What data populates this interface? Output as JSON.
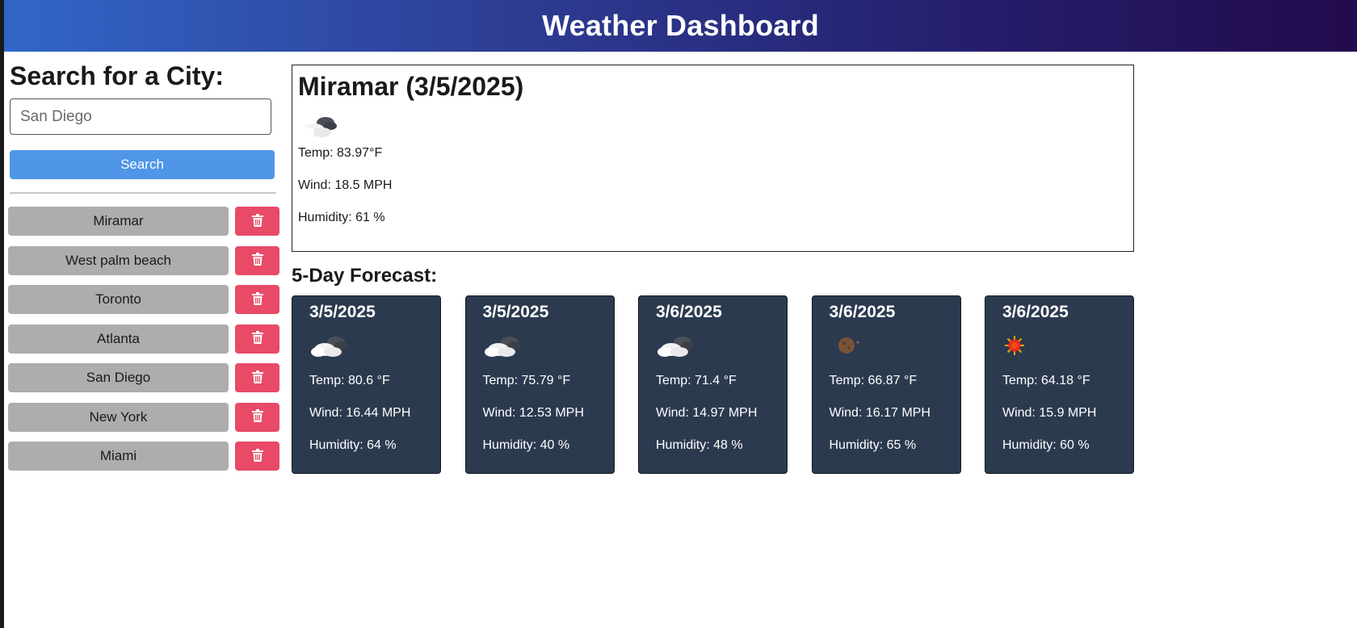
{
  "header": {
    "title": "Weather Dashboard"
  },
  "sidebar": {
    "heading": "Search for a City:",
    "search_placeholder": "San Diego",
    "search_button": "Search",
    "history": [
      {
        "city": "Miramar"
      },
      {
        "city": "West palm beach"
      },
      {
        "city": "Toronto"
      },
      {
        "city": "Atlanta"
      },
      {
        "city": "San Diego"
      },
      {
        "city": "New York"
      },
      {
        "city": "Miami"
      }
    ]
  },
  "current": {
    "title": "Miramar (3/5/2025)",
    "icon": "cloud-icon",
    "temp": "Temp: 83.97°F",
    "wind": "Wind: 18.5 MPH",
    "humidity": "Humidity: 61 %"
  },
  "forecast": {
    "title": "5-Day Forecast:",
    "days": [
      {
        "date": "3/5/2025",
        "icon": "cloud-icon",
        "temp": "Temp: 80.6 °F",
        "wind": "Wind: 16.44 MPH",
        "humidity": "Humidity: 64 %"
      },
      {
        "date": "3/5/2025",
        "icon": "cloud-icon",
        "temp": "Temp: 75.79 °F",
        "wind": "Wind: 12.53 MPH",
        "humidity": "Humidity: 40 %"
      },
      {
        "date": "3/6/2025",
        "icon": "cloud-icon",
        "temp": "Temp: 71.4 °F",
        "wind": "Wind: 14.97 MPH",
        "humidity": "Humidity: 48 %"
      },
      {
        "date": "3/6/2025",
        "icon": "moon-icon",
        "temp": "Temp: 66.87 °F",
        "wind": "Wind: 16.17 MPH",
        "humidity": "Humidity: 65 %"
      },
      {
        "date": "3/6/2025",
        "icon": "sun-icon",
        "temp": "Temp: 64.18 °F",
        "wind": "Wind: 15.9 MPH",
        "humidity": "Humidity: 60 %"
      }
    ]
  },
  "colors": {
    "header_gradient_start": "#3166c8",
    "header_gradient_end": "#220a4c",
    "search_button": "#4f96e8",
    "history_button": "#adadad",
    "delete_button": "#e84a67",
    "card_background": "#2c3a4f"
  }
}
